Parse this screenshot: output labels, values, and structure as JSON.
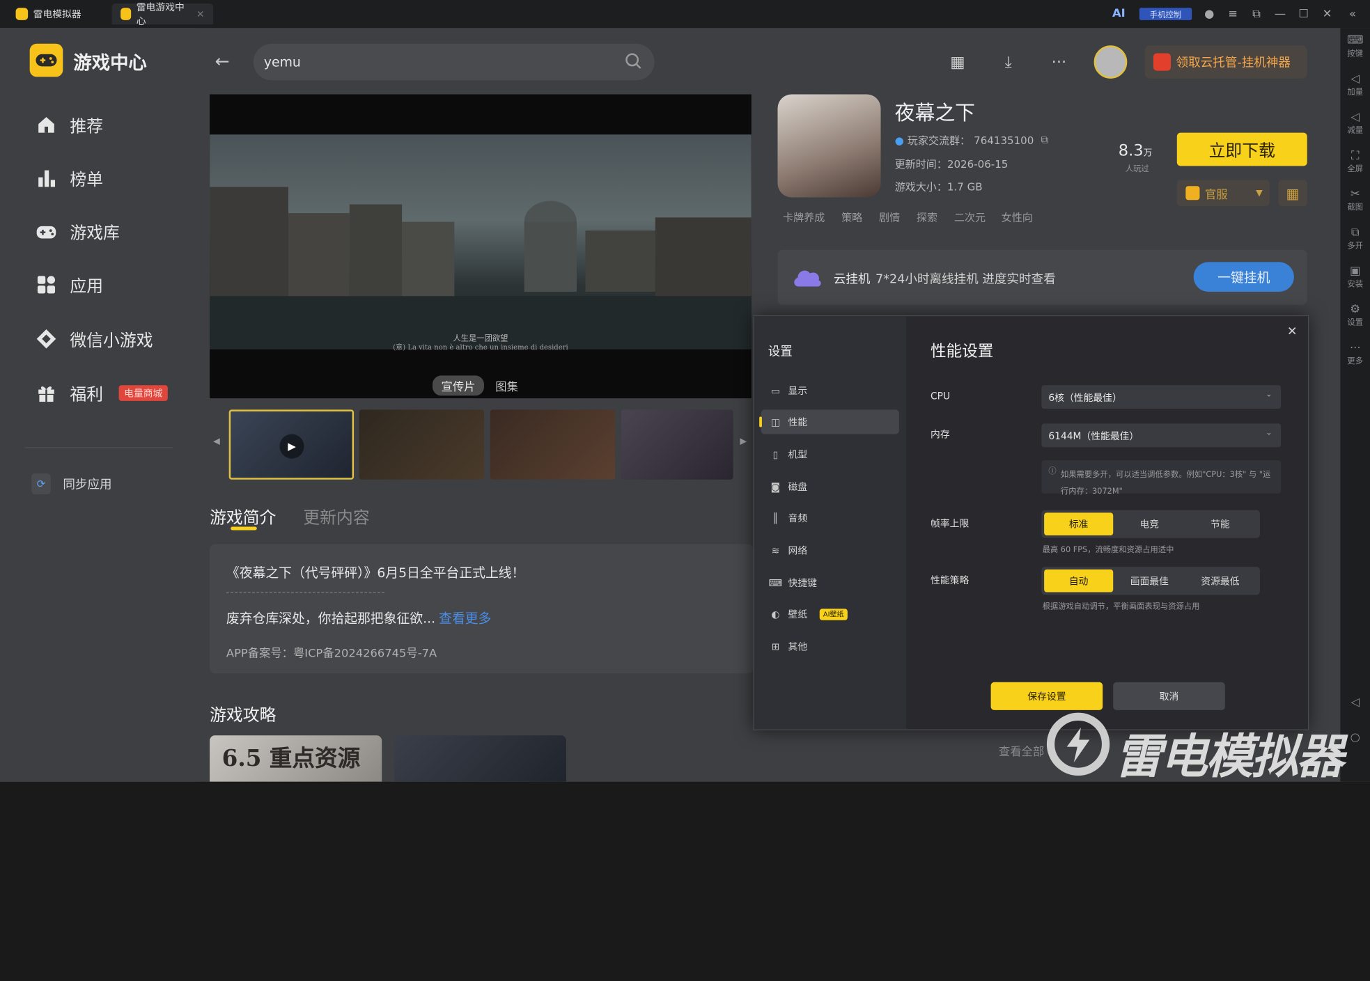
{
  "titlebar": {
    "tabs": [
      {
        "label": "雷电模拟器",
        "icon": "leidian-logo-icon"
      },
      {
        "label": "雷电游戏中心",
        "icon": "game-center-icon"
      }
    ],
    "ai_label": "AI",
    "phone_control_label": "手机控制"
  },
  "rightbar": {
    "items": [
      "按键",
      "加量",
      "减量",
      "全屏",
      "截图",
      "多开",
      "安装",
      "设置",
      "更多"
    ]
  },
  "sidebar": {
    "app_title": "游戏中心",
    "items": [
      {
        "label": "推荐",
        "icon": "home-icon"
      },
      {
        "label": "榜单",
        "icon": "bar-chart-icon"
      },
      {
        "label": "游戏库",
        "icon": "gamepad-icon"
      },
      {
        "label": "应用",
        "icon": "apps-icon"
      },
      {
        "label": "微信小游戏",
        "icon": "wechat-game-icon"
      },
      {
        "label": "福利",
        "icon": "gift-icon",
        "badge": "电量商城"
      }
    ],
    "sync_label": "同步应用"
  },
  "search": {
    "value": "yemu"
  },
  "header": {
    "promo_label": "领取云托管-挂机神器"
  },
  "video": {
    "subtitle_cn": "人生是一团欲望",
    "subtitle_it": "(意) La vita non è altro che un insieme di desideri",
    "tab_trailer": "宣传片",
    "tab_gallery": "图集"
  },
  "game": {
    "title": "夜幕之下",
    "qq_group_label": "玩家交流群：",
    "qq_group": "764135100",
    "update_label": "更新时间：",
    "update_date": "2026-06-15",
    "size_label": "游戏大小：",
    "size": "1.7 GB",
    "players_count": "8.3",
    "players_unit": "万",
    "players_label": "人玩过",
    "download_button": "立即下载",
    "server_label": "官服",
    "tags": [
      "卡牌养成",
      "策略",
      "剧情",
      "探索",
      "二次元",
      "女性向"
    ]
  },
  "cloud": {
    "title": "云挂机",
    "desc": "7*24小时离线挂机 进度实时查看",
    "button": "一键挂机"
  },
  "intro": {
    "tab_intro": "游戏简介",
    "tab_update": "更新内容",
    "headline": "《夜幕之下（代号砰砰）》6月5日全平台正式上线！",
    "body": "废弃仓库深处，你拾起那把象征欲...",
    "more_link": "查看更多",
    "icp": "APP备案号：粤ICP备2024266745号-7A"
  },
  "guides": {
    "title": "游戏攻略",
    "card1_text": "6.5 重点资源",
    "view_all": "查看全部"
  },
  "settings": {
    "title": "设置",
    "menu": [
      {
        "label": "显示",
        "icon": "monitor-icon"
      },
      {
        "label": "性能",
        "icon": "performance-icon"
      },
      {
        "label": "机型",
        "icon": "phone-icon"
      },
      {
        "label": "磁盘",
        "icon": "disk-icon"
      },
      {
        "label": "音频",
        "icon": "audio-icon"
      },
      {
        "label": "网络",
        "icon": "wifi-icon"
      },
      {
        "label": "快捷键",
        "icon": "keyboard-icon"
      },
      {
        "label": "壁纸",
        "icon": "palette-icon",
        "badge": "AI壁纸"
      },
      {
        "label": "其他",
        "icon": "grid-icon"
      }
    ],
    "active_index": 1,
    "panel_title": "性能设置",
    "cpu_label": "CPU",
    "cpu_value": "6核（性能最佳）",
    "memory_label": "内存",
    "memory_value": "6144M（性能最佳）",
    "memory_hint": "如果需要多开，可以适当调低参数。例如\"CPU：3核\" 与 \"运行内存：3072M\"",
    "fps_label": "帧率上限",
    "fps_options": [
      "标准",
      "电竞",
      "节能"
    ],
    "fps_selected": 0,
    "fps_hint": "最高 60 FPS，流畅度和资源占用适中",
    "strategy_label": "性能策略",
    "strategy_options": [
      "自动",
      "画面最佳",
      "资源最低"
    ],
    "strategy_selected": 0,
    "strategy_hint": "根据游戏自动调节，平衡画面表现与资源占用",
    "save_button": "保存设置",
    "cancel_button": "取消"
  },
  "watermark": {
    "text": "雷电模拟器"
  },
  "colors": {
    "accent": "#f8d11a",
    "panel": "#29292d",
    "link": "#4a8ee8",
    "badge_red": "#e0463c"
  }
}
